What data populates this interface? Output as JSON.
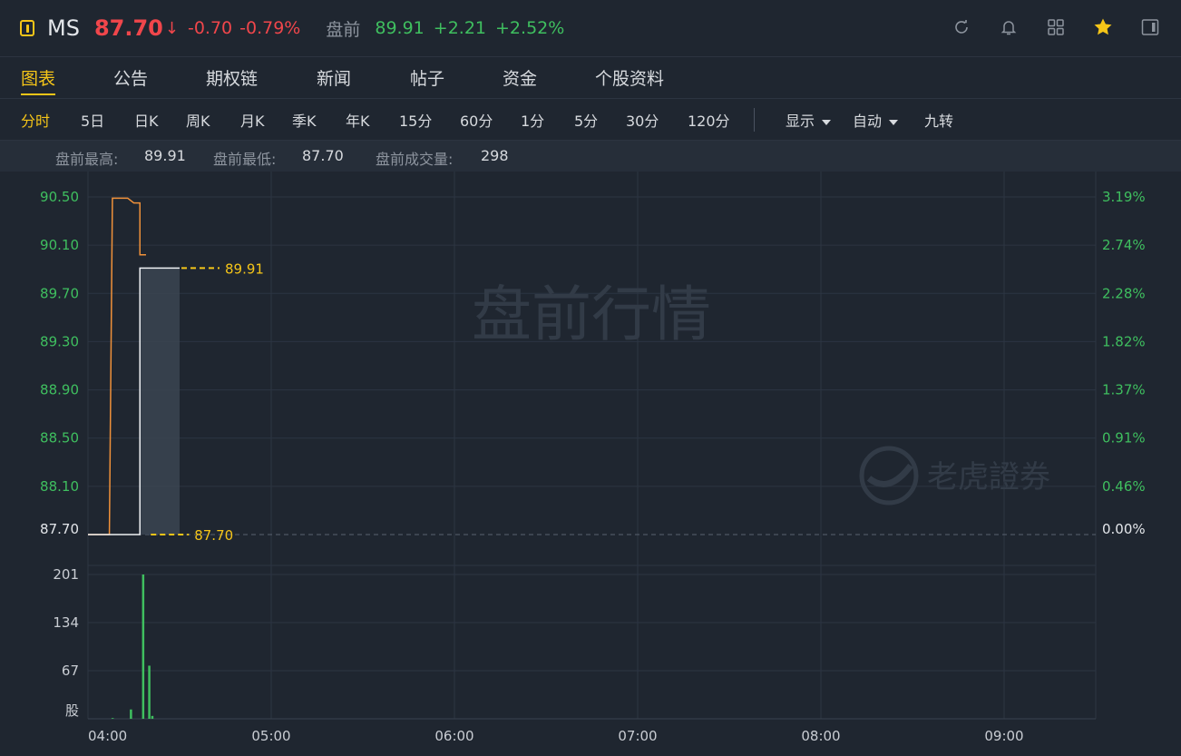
{
  "header": {
    "symbol": "MS",
    "price": "87.70",
    "price_arrow": "↓",
    "change": "-0.70",
    "change_pct": "-0.79%",
    "premarket_label": "盘前",
    "premarket_price": "89.91",
    "premarket_change": "+2.21",
    "premarket_change_pct": "+2.52%",
    "icons": [
      "refresh-icon",
      "bell-icon",
      "grid-icon",
      "star-icon",
      "panel-icon"
    ]
  },
  "tabs": [
    {
      "label": "图表",
      "active": true
    },
    {
      "label": "公告"
    },
    {
      "label": "期权链"
    },
    {
      "label": "新闻"
    },
    {
      "label": "帖子"
    },
    {
      "label": "资金"
    },
    {
      "label": "个股资料"
    }
  ],
  "periods": [
    {
      "label": "分时",
      "active": true
    },
    {
      "label": "5日"
    },
    {
      "label": "日K"
    },
    {
      "label": "周K"
    },
    {
      "label": "月K"
    },
    {
      "label": "季K"
    },
    {
      "label": "年K"
    },
    {
      "label": "15分"
    },
    {
      "label": "60分"
    },
    {
      "label": "1分"
    },
    {
      "label": "5分"
    },
    {
      "label": "30分"
    },
    {
      "label": "120分"
    }
  ],
  "display_menu": {
    "label": "显示"
  },
  "auto_menu": {
    "label": "自动"
  },
  "nine_turn": {
    "label": "九转"
  },
  "stats": {
    "high_label": "盘前最高:",
    "high_value": "89.91",
    "low_label": "盘前最低:",
    "low_value": "87.70",
    "volume_label": "盘前成交量:",
    "volume_value": "298"
  },
  "watermark": {
    "session": "盘前行情",
    "brand": "老虎證券"
  },
  "colors": {
    "up": "#3fbf5f",
    "down": "#f0464b",
    "accent": "#f5c518",
    "price_line": "#eef0f3",
    "avg_line": "#f0913a"
  },
  "chart_data": {
    "type": "line",
    "price_axis": {
      "ticks": [
        "90.50",
        "90.10",
        "89.70",
        "89.30",
        "88.90",
        "88.50",
        "88.10",
        "87.70"
      ],
      "ylim": [
        87.7,
        90.5
      ]
    },
    "pct_axis": {
      "ticks": [
        "3.19%",
        "2.74%",
        "2.28%",
        "1.82%",
        "1.37%",
        "0.91%",
        "0.46%",
        "0.00%"
      ]
    },
    "volume_axis": {
      "ticks": [
        "201",
        "134",
        "67"
      ],
      "unit": "股",
      "ylim": [
        0,
        201
      ]
    },
    "time_axis": {
      "ticks": [
        "04:00",
        "05:00",
        "06:00",
        "07:00",
        "08:00",
        "09:00"
      ],
      "range_minutes": [
        0,
        330
      ]
    },
    "price_series": {
      "x": [
        0,
        16,
        16,
        17,
        17,
        19,
        30
      ],
      "y": [
        87.7,
        87.7,
        87.7,
        87.7,
        89.91,
        89.91,
        89.91
      ]
    },
    "avg_series": {
      "x": [
        0,
        7,
        8,
        13,
        15,
        17,
        17,
        19
      ],
      "y": [
        87.7,
        87.7,
        90.49,
        90.49,
        90.45,
        90.45,
        90.02,
        90.02
      ]
    },
    "volume_series": {
      "x": [
        8,
        14,
        18,
        20,
        21
      ],
      "values": [
        1,
        13,
        201,
        74,
        4
      ]
    },
    "markers": {
      "high": {
        "value": "89.91",
        "y": 89.91
      },
      "low": {
        "value": "87.70",
        "y": 87.7
      }
    }
  }
}
